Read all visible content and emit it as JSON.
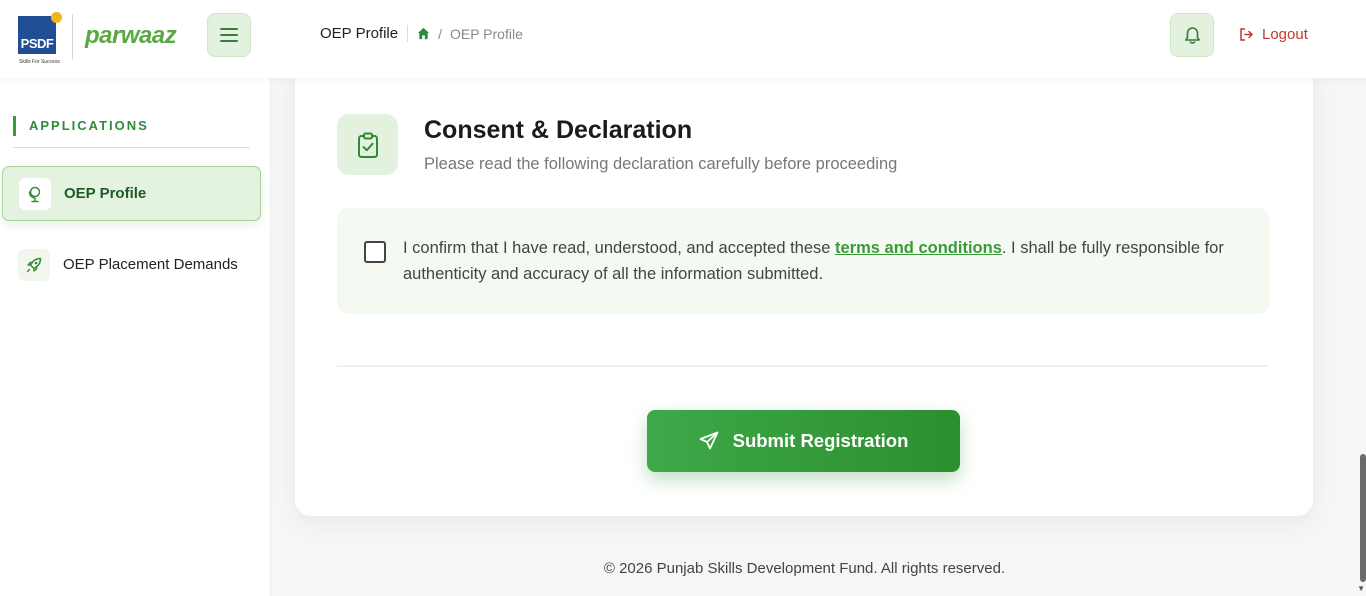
{
  "brand": {
    "psdf_text": "PSDF",
    "psdf_tagline": "Skills For Success",
    "app_name": "parwaaz",
    "accent": "#3a9a3a"
  },
  "header": {
    "page_title": "OEP Profile",
    "breadcrumb_current": "OEP Profile",
    "breadcrumb_separator": "/",
    "logout_label": "Logout",
    "menu_icon": "hamburger-icon",
    "bell_icon": "bell-icon"
  },
  "sidebar": {
    "section_label": "APPLICATIONS",
    "items": [
      {
        "label": "OEP Profile",
        "icon": "globe-stand-icon",
        "active": true
      },
      {
        "label": "OEP Placement Demands",
        "icon": "rocket-icon",
        "active": false
      }
    ]
  },
  "consent": {
    "title": "Consent & Declaration",
    "subtitle": "Please read the following declaration carefully before proceeding",
    "text_before": "I confirm that I have read, understood, and accepted these ",
    "link_text": "terms and conditions",
    "text_after": ". I shall be fully responsible for authenticity and accuracy of all the information submitted.",
    "checked": false
  },
  "submit": {
    "label": "Submit Registration"
  },
  "footer": {
    "text": "© 2026 Punjab Skills Development Fund. All rights reserved."
  }
}
